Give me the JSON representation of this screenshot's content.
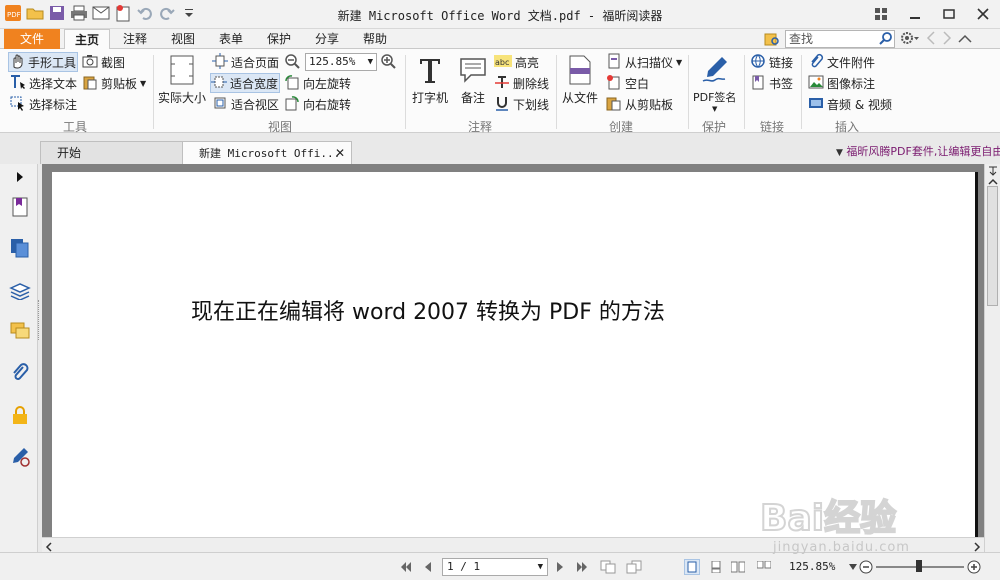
{
  "window": {
    "title": "新建 Microsoft Office Word 文档.pdf - 福昕阅读器"
  },
  "menu": {
    "file": "文件",
    "tabs": [
      "主页",
      "注释",
      "视图",
      "表单",
      "保护",
      "分享",
      "帮助"
    ]
  },
  "search": {
    "placeholder": "查找"
  },
  "ribbon": {
    "tools": {
      "label": "工具",
      "hand": "手形工具",
      "select_text": "选择文本",
      "select_annot": "选择标注",
      "snapshot": "截图",
      "clipboard": "剪贴板"
    },
    "view": {
      "label": "视图",
      "actual_size": "实际大小",
      "fit_page": "适合页面",
      "fit_width": "适合宽度",
      "fit_visible": "适合视区",
      "zoom_value": "125.85%",
      "rotate_left": "向左旋转",
      "rotate_right": "向右旋转"
    },
    "annotate": {
      "label": "注释",
      "typewriter": "打字机",
      "note": "备注",
      "highlight": "高亮",
      "strikeout": "删除线",
      "underline": "下划线"
    },
    "create": {
      "label": "创建",
      "from_file": "从文件",
      "from_scanner": "从扫描仪",
      "blank": "空白",
      "from_clipboard": "从剪贴板"
    },
    "protect": {
      "label": "保护",
      "pdf_sign": "PDF签名"
    },
    "links": {
      "label": "链接",
      "link": "链接",
      "bookmark": "书签"
    },
    "insert": {
      "label": "插入",
      "attachment": "文件附件",
      "image_annot": "图像标注",
      "audio_video": "音频 & 视频"
    }
  },
  "doc_tabs": {
    "start": "开始",
    "current": "新建 Microsoft Offi..."
  },
  "promo": "福昕风腾PDF套件,让编辑更自由",
  "document": {
    "text": "现在正在编辑将 word 2007 转换为 PDF 的方法"
  },
  "status": {
    "page": "1 / 1",
    "zoom": "125.85%"
  },
  "watermark": {
    "brand": "Bai经验",
    "url": "jingyan.baidu.com"
  },
  "colors": {
    "accent": "#f0821f",
    "selected": "#dbe7f5",
    "promo": "#7a1a6f"
  }
}
